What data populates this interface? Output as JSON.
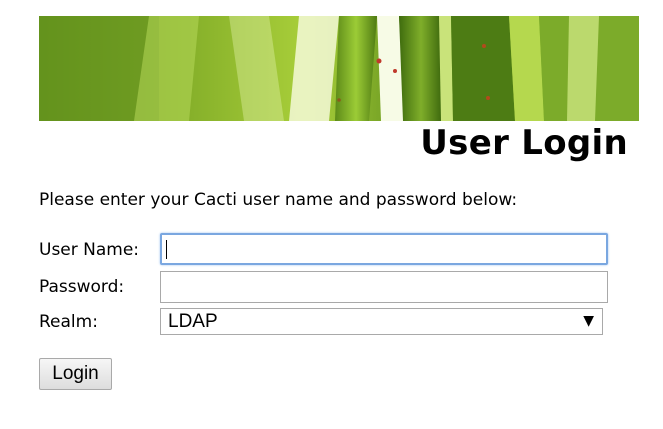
{
  "header": {
    "title": "User Login",
    "banner_image": "green-leaf-banner"
  },
  "form": {
    "intro": "Please enter your Cacti user name and password below:",
    "username_label": "User Name:",
    "username_value": "",
    "password_label": "Password:",
    "password_value": "",
    "realm_label": "Realm:",
    "realm_selected": "LDAP",
    "login_button": "Login"
  },
  "icons": {
    "select_arrow": "chevron-down-icon"
  },
  "colors": {
    "focus_border": "#7aa7e0",
    "banner_green": "#8bb428"
  }
}
